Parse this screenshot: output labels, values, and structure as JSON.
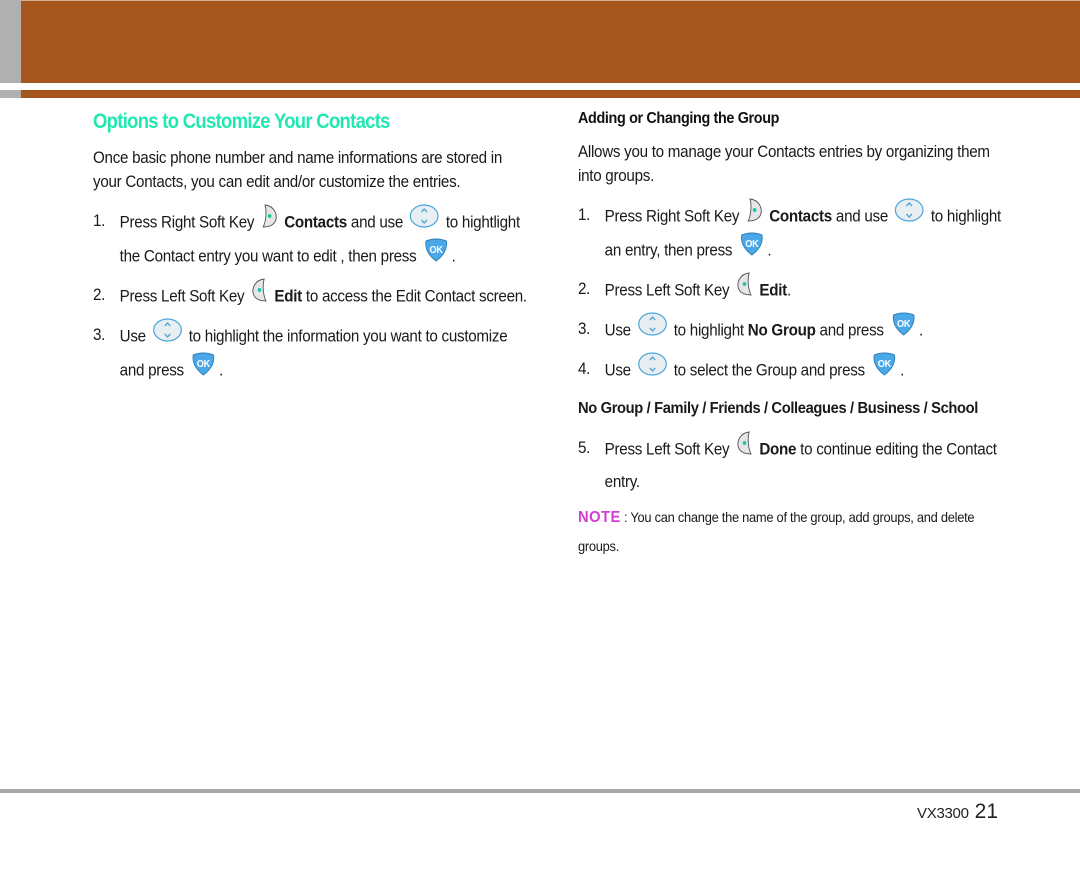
{
  "header": {
    "band_color": "#a4561c",
    "tab_color": "#b0b0b0"
  },
  "left": {
    "title": "Options to Customize Your Contacts",
    "title_color": "#22e8b0",
    "intro": "Once basic phone number and name informations are stored in your Contacts, you can edit and/or customize the entries.",
    "steps": [
      {
        "num": "1.",
        "parts": [
          "Press Right Soft Key",
          "Contacts",
          "and use",
          "to hightlight the Contact entry you want to edit , then press",
          "."
        ]
      },
      {
        "num": "2.",
        "parts": [
          "Press Left Soft Key",
          "Edit",
          "to access the Edit Contact screen."
        ]
      },
      {
        "num": "3.",
        "parts": [
          "Use",
          "to highlight the information you want to customize and press",
          "."
        ]
      }
    ]
  },
  "right": {
    "heading": "Adding or Changing the Group",
    "intro": "Allows you to manage your Contacts entries by organizing them into groups.",
    "steps": [
      {
        "num": "1.",
        "parts": [
          "Press Right Soft Key",
          "Contacts",
          "and use",
          "to",
          "highlight an entry, then press",
          "."
        ]
      },
      {
        "num": "2.",
        "parts": [
          "Press Left Soft Key",
          "Edit",
          "."
        ]
      },
      {
        "num": "3.",
        "parts": [
          "Use",
          "to highlight",
          "No Group",
          "and press",
          "."
        ]
      },
      {
        "num": "4.",
        "parts": [
          "Use",
          "to select the Group and press",
          "."
        ]
      },
      {
        "num": "5.",
        "parts": [
          "Press Left Soft Key",
          "Done",
          "to continue editing the Contact entry."
        ]
      }
    ],
    "group_options": "No Group / Family / Friends / Colleagues / Business / School",
    "note_label": "NOTE",
    "note_text": " : You can change the name of the group, add groups, and delete groups.",
    "note_color": "#d63bd6"
  },
  "icons": {
    "right_soft_key": "right-soft-key-icon",
    "left_soft_key": "left-soft-key-icon",
    "nav_key": "navigation-key-icon",
    "ok_key": "ok-key-icon",
    "ok_label": "OK"
  },
  "footer": {
    "model": "VX3300",
    "page": "21"
  }
}
